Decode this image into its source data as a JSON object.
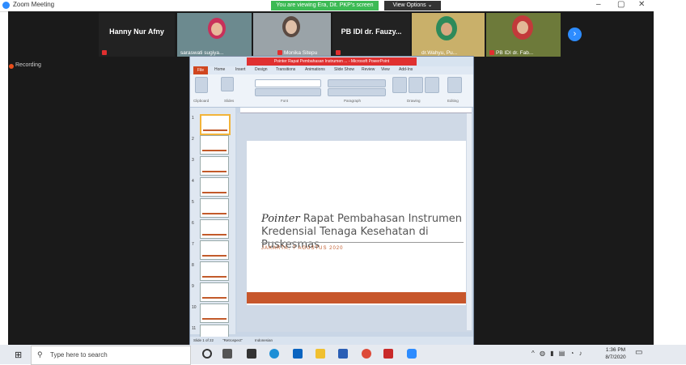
{
  "window": {
    "title": "Zoom Meeting",
    "minimize": "–",
    "maximize": "▢",
    "close": "✕"
  },
  "banner": {
    "viewing": "You are viewing Era, Dit. PKP's screen",
    "view_options": "View Options ⌄"
  },
  "participants": [
    {
      "name": "Hanny Nur Afny",
      "label": "",
      "has_video": false
    },
    {
      "name": "",
      "label": "saraswati sugiya...",
      "has_video": true
    },
    {
      "name": "",
      "label": "Monika Sitepu",
      "has_video": true
    },
    {
      "name": "PB IDI dr. Fauzy...",
      "label": "",
      "has_video": false
    },
    {
      "name": "",
      "label": "dr.Wahyu, Pu...",
      "has_video": true
    },
    {
      "name": "",
      "label": "PB IDI dr. Fab...",
      "has_video": true
    }
  ],
  "recording": "Recording",
  "ppt": {
    "title": "Pointer Rapat Pembahasan Instrumen ... - Microsoft PowerPoint",
    "tabs": [
      "File",
      "Home",
      "Insert",
      "Design",
      "Transitions",
      "Animations",
      "Slide Show",
      "Review",
      "View",
      "Add-Ins"
    ],
    "groups": [
      "Clipboard",
      "Slides",
      "Font",
      "Paragraph",
      "Drawing",
      "Editing"
    ],
    "slide_title_italic": "Pointer",
    "slide_title_rest1": " Rapat Pembahasan Instrumen",
    "slide_title_line2": "Kredensial Tenaga Kesehatan di Puskesmas",
    "slide_subtitle": "JAKARTA, 7 AGUSTUS 2020",
    "status_left": "Slide 1 of 22",
    "status_theme": "\"Retrospect\"",
    "status_lang": "Indonesian",
    "thumb_numbers": [
      "1",
      "2",
      "3",
      "4",
      "5",
      "6",
      "7",
      "8",
      "9",
      "10",
      "11"
    ]
  },
  "taskbar": {
    "search_placeholder": "Type here to search",
    "time": "1:36 PM",
    "date": "8/7/2020"
  }
}
